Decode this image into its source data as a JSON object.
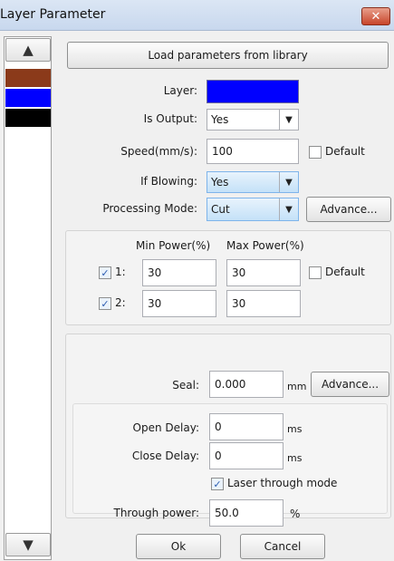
{
  "window": {
    "title": "Layer Parameter",
    "close_glyph": "✕"
  },
  "layer_list": {
    "up_glyph": "▲",
    "down_glyph": "▼",
    "swatches": [
      "#8b3a1a",
      "#0000ff",
      "#000000"
    ]
  },
  "load_button": "Load parameters from library",
  "layer": {
    "label": "Layer:",
    "color": "#0000ff"
  },
  "is_output": {
    "label": "Is Output:",
    "value": "Yes"
  },
  "speed": {
    "label": "Speed(mm/s):",
    "value": "100",
    "default_label": "Default",
    "default_checked": false
  },
  "if_blowing": {
    "label": "If Blowing:",
    "value": "Yes"
  },
  "processing_mode": {
    "label": "Processing Mode:",
    "value": "Cut",
    "advance_label": "Advance..."
  },
  "power": {
    "min_header": "Min Power(%)",
    "max_header": "Max Power(%)",
    "default_label": "Default",
    "default_checked": false,
    "rows": [
      {
        "label": "1:",
        "checked": true,
        "min": "30",
        "max": "30"
      },
      {
        "label": "2:",
        "checked": true,
        "min": "30",
        "max": "30"
      }
    ]
  },
  "seal": {
    "label": "Seal:",
    "value": "0.000",
    "unit": "mm",
    "advance_label": "Advance..."
  },
  "open_delay": {
    "label": "Open Delay:",
    "value": "0",
    "unit": "ms"
  },
  "close_delay": {
    "label": "Close Delay:",
    "value": "0",
    "unit": "ms"
  },
  "laser_through": {
    "label": "Laser through mode",
    "checked": true
  },
  "through_power": {
    "label": "Through power:",
    "value": "50.0",
    "unit": "%"
  },
  "footer": {
    "ok": "Ok",
    "cancel": "Cancel"
  },
  "check_glyph": "✓",
  "dropdown_glyph": "▼"
}
